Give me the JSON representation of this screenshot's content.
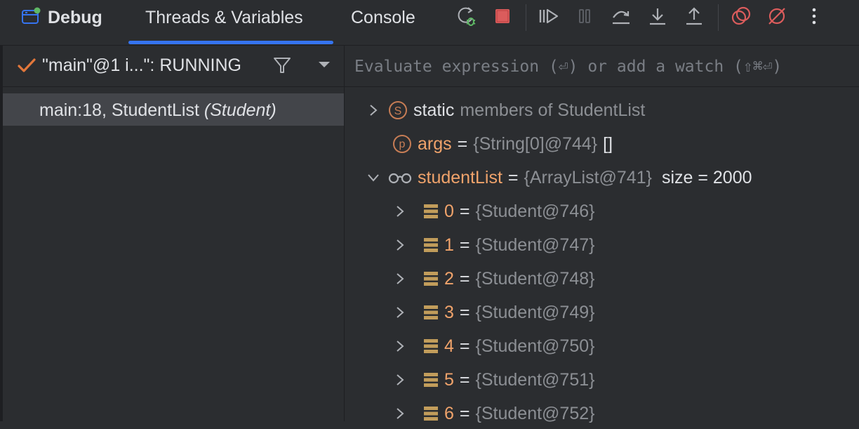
{
  "toolbar": {
    "title": "Debug",
    "tabs": [
      {
        "label": "Threads & Variables",
        "active": true
      },
      {
        "label": "Console",
        "active": false
      }
    ],
    "buttons": [
      "rerun-debug",
      "stop",
      "resume",
      "pause",
      "step-over",
      "step-into",
      "step-out",
      "view-breakpoints",
      "mute-breakpoints",
      "more"
    ]
  },
  "threads": {
    "selected": "\"main\"@1 i...\": RUNNING",
    "status": "checked"
  },
  "frames": [
    {
      "location": "main:18, StudentList",
      "class": "(Student)"
    }
  ],
  "evaluate": {
    "placeholder": "Evaluate expression (⏎) or add a watch (⇧⌘⏎)"
  },
  "variables": {
    "static": {
      "name": "static",
      "desc": "members of StudentList"
    },
    "args": {
      "badge": "p",
      "name": "args",
      "eq": "=",
      "value": "{String[0]@744}",
      "extra": "[]"
    },
    "studentList": {
      "name": "studentList",
      "eq": "=",
      "value": "{ArrayList@741}",
      "size_label": "size = 2000"
    },
    "items": [
      {
        "index": "0",
        "eq": "=",
        "value": "{Student@746}"
      },
      {
        "index": "1",
        "eq": "=",
        "value": "{Student@747}"
      },
      {
        "index": "2",
        "eq": "=",
        "value": "{Student@748}"
      },
      {
        "index": "3",
        "eq": "=",
        "value": "{Student@749}"
      },
      {
        "index": "4",
        "eq": "=",
        "value": "{Student@750}"
      },
      {
        "index": "5",
        "eq": "=",
        "value": "{Student@751}"
      },
      {
        "index": "6",
        "eq": "=",
        "value": "{Student@752}"
      }
    ]
  },
  "colors": {
    "accent": "#3574f0",
    "stop": "#db5c5c",
    "bug": "#5fb865",
    "badge": "#c77d55",
    "field": "#c29d5b",
    "name_orange": "#f0a36b",
    "value_gray": "#8c8f94"
  }
}
